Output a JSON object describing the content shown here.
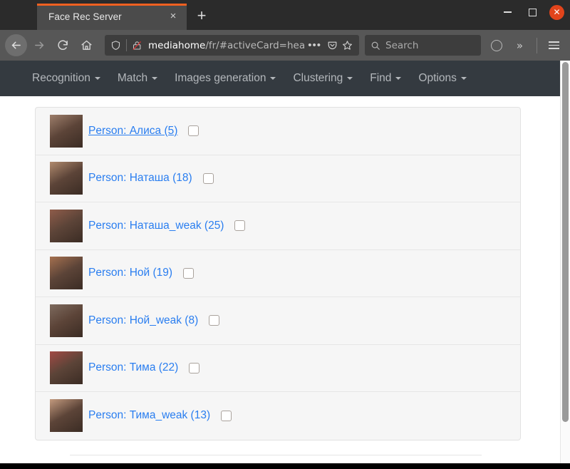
{
  "browser": {
    "tab": {
      "title": "Face Rec Server",
      "close_label": "×",
      "new_tab_label": "+"
    },
    "window_controls": {
      "minimize_label": "",
      "maximize_label": "",
      "close_label": "✕"
    },
    "toolbar": {
      "back_label": "",
      "forward_label": "",
      "reload_label": "",
      "home_label": "",
      "url_host": "mediahome",
      "url_path": "/fr/#activeCard=headin",
      "page_actions_label": "•••",
      "pocket_label": "",
      "bookmark_label": "",
      "search_placeholder": "Search",
      "account_label": "",
      "overflow_label": "»",
      "menu_label": ""
    }
  },
  "app": {
    "nav_items": [
      {
        "label": "Recognition"
      },
      {
        "label": "Match"
      },
      {
        "label": "Images generation"
      },
      {
        "label": "Clustering"
      },
      {
        "label": "Find"
      },
      {
        "label": "Options"
      }
    ],
    "persons": [
      {
        "label": "Person: Алиса (5)",
        "hovered": true,
        "checked": false,
        "thumb": "#9d7e6b"
      },
      {
        "label": "Person: Наташа (18)",
        "hovered": false,
        "checked": false,
        "thumb": "#b08a6e"
      },
      {
        "label": "Person: Наташа_weak (25)",
        "hovered": false,
        "checked": false,
        "thumb": "#8f5c4a"
      },
      {
        "label": "Person: Ной (19)",
        "hovered": false,
        "checked": false,
        "thumb": "#a5704f"
      },
      {
        "label": "Person: Ной_weak (8)",
        "hovered": false,
        "checked": false,
        "thumb": "#7d6a5e"
      },
      {
        "label": "Person: Тима (22)",
        "hovered": false,
        "checked": false,
        "thumb": "#a24a45"
      },
      {
        "label": "Person: Тима_weak (13)",
        "hovered": false,
        "checked": false,
        "thumb": "#c39a7e"
      }
    ]
  },
  "colors": {
    "accent_orange": "#f06020",
    "link_blue": "#2a7ef0",
    "navbar_dark": "#343a40",
    "close_red": "#e2441b"
  }
}
